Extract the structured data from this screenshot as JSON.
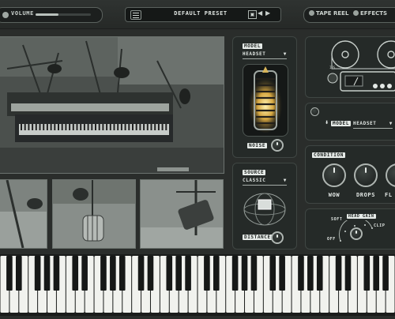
{
  "topbar": {
    "volume_label": "VOLUME",
    "volume_level": 0.42,
    "preset_name": "DEFAULT PRESET",
    "save_icon": "save-icon",
    "tape_reel_tab": "TAPE REEL",
    "effects_tab": "EFFECTS"
  },
  "mic_panel": {
    "caption": "MODEL",
    "model_value": "HEADSET",
    "noise_label": "NOISE"
  },
  "source_panel": {
    "caption": "SOURCE",
    "source_value": "CLASSIC",
    "distance_label": "DISTANCE"
  },
  "tape_panel": {
    "model_label": "MODEL",
    "model_value": "HEADSET"
  },
  "condition_panel": {
    "caption": "CONDITION",
    "knobs": [
      "WOW",
      "DROPS",
      "FL"
    ]
  },
  "speed_panel": {
    "soft_label": "SOFT",
    "head_gain_label": "HEAD GAIN",
    "clip_label": "CLIP",
    "off_label": "OFF"
  },
  "keyboard": {
    "white_key_count": 42
  }
}
